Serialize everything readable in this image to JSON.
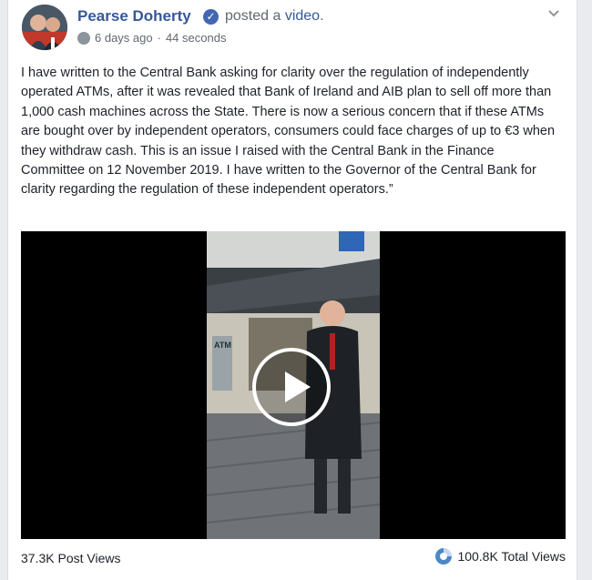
{
  "post": {
    "author": "Pearse Doherty",
    "verified_icon": "verified-badge-icon",
    "action_prefix": "posted a ",
    "action_link": "video",
    "action_suffix": ".",
    "time": "6 days ago",
    "separator": "·",
    "duration": "44 seconds",
    "text": "I have written to the Central Bank asking for clarity over the regulation of independently operated ATMs, after it was revealed that Bank of Ireland and AIB plan to sell off more than 1,000 cash machines across the State. There is now a serious concern that if these ATMs are bought over by independent operators, consumers could face charges of up to €3 when they withdraw cash. This is an issue I raised with the Central Bank in the Finance Committee on 12 November 2019. I have written to the Governor of the Central Bank for clarity regarding the regulation of these independent operators.”",
    "video": {
      "sign_text": "ATM"
    }
  },
  "footer": {
    "post_views": "37.3K Post Views",
    "total_views": "100.8K Total Views"
  },
  "colors": {
    "link": "#365899",
    "meta": "#616770",
    "accent": "#4267b2"
  }
}
